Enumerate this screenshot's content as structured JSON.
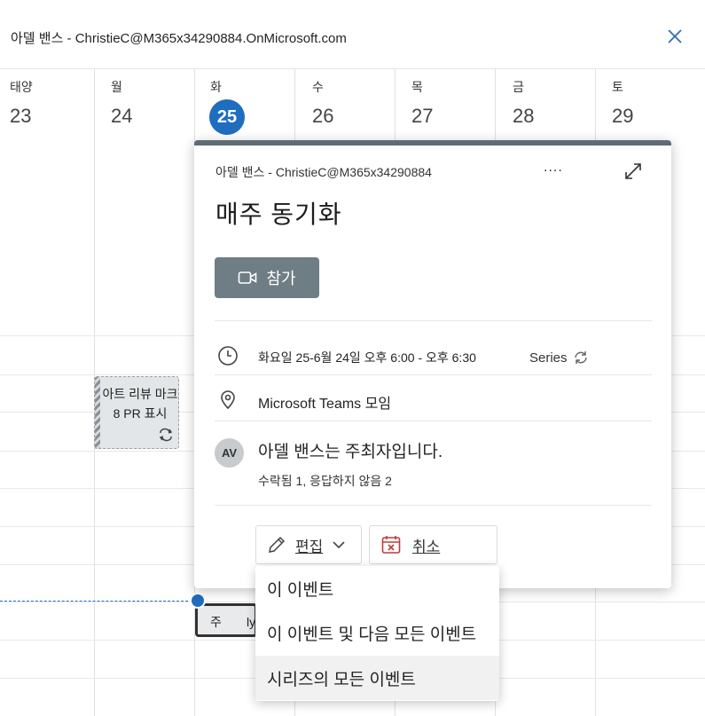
{
  "window": {
    "title": "아델 밴스 - ChristieC@M365x34290884.OnMicrosoft.com"
  },
  "calendar": {
    "days": [
      {
        "name": "태양",
        "num": "23"
      },
      {
        "name": "월",
        "num": "24"
      },
      {
        "name": "화",
        "num": "25",
        "today": true
      },
      {
        "name": "수",
        "num": "26"
      },
      {
        "name": "목",
        "num": "27"
      },
      {
        "name": "금",
        "num": "28"
      },
      {
        "name": "토",
        "num": "29"
      }
    ],
    "events": {
      "review": "아트 리뷰 마크 8 PR 표시",
      "selected_a": "주",
      "selected_b": "ly"
    }
  },
  "card": {
    "owner": "아델 밴스 - ChristieC@M365x34290884",
    "more": "....",
    "subject": "매주 동기화",
    "join_label": "참가",
    "time": "화요일 25-6월 24일 오후 6:00 - 오후 6:30",
    "series": "Series",
    "location": "Microsoft Teams 모임",
    "avatar": "AV",
    "organizer": "아델 밴스는 주최자입니다.",
    "responses": "수락됨 1, 응답하지 않음 2",
    "edit_label": "편집",
    "cancel_label": "취소"
  },
  "menu": {
    "items": [
      "이 이벤트",
      "이 이벤트 및 다음 모든 이벤트",
      "시리즈의 모든 이벤트"
    ]
  },
  "colors": {
    "accent": "#1f6dbf",
    "card_header": "#5e6d75",
    "join_button": "#6f7d84",
    "cancel_icon": "#c13a3a"
  }
}
